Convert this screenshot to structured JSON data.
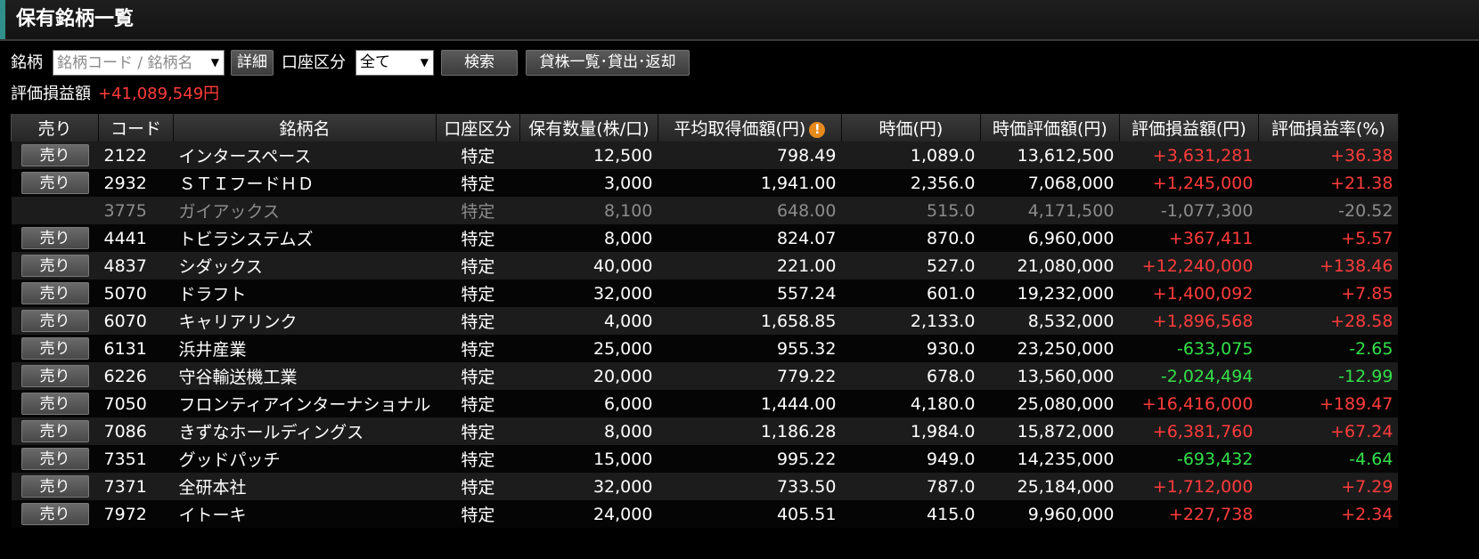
{
  "page": {
    "title": "保有銘柄一覧",
    "accent_color": "#2f8f8a"
  },
  "filters": {
    "symbol_label": "銘柄",
    "symbol_placeholder": "銘柄コード / 銘柄名",
    "detail_button": "詳細",
    "account_label": "口座区分",
    "account_selected": "全て",
    "search_button": "検索",
    "lending_button": "貸株一覧･貸出･返却"
  },
  "summary": {
    "label": "評価損益額",
    "value": "+41,089,549円"
  },
  "table": {
    "headers": [
      "売り",
      "コード",
      "銘柄名",
      "口座区分",
      "保有数量(株/口)",
      "平均取得価額(円)",
      "時価(円)",
      "時価評価額(円)",
      "評価損益額(円)",
      "評価損益率(%)"
    ],
    "sell_label": "売り",
    "rows": [
      {
        "sell": true,
        "code": "2122",
        "name": "インタースペース",
        "account": "特定",
        "qty": "12,500",
        "avg": "798.49",
        "price": "1,089.0",
        "value": "13,612,500",
        "pl": "+3,631,281",
        "rate": "+36.38",
        "status": "pos"
      },
      {
        "sell": true,
        "code": "2932",
        "name": "ＳＴＩフードＨＤ",
        "account": "特定",
        "qty": "3,000",
        "avg": "1,941.00",
        "price": "2,356.0",
        "value": "7,068,000",
        "pl": "+1,245,000",
        "rate": "+21.38",
        "status": "pos"
      },
      {
        "sell": false,
        "code": "3775",
        "name": "ガイアックス",
        "account": "特定",
        "qty": "8,100",
        "avg": "648.00",
        "price": "515.0",
        "value": "4,171,500",
        "pl": "-1,077,300",
        "rate": "-20.52",
        "status": "grey"
      },
      {
        "sell": true,
        "code": "4441",
        "name": "トビラシステムズ",
        "account": "特定",
        "qty": "8,000",
        "avg": "824.07",
        "price": "870.0",
        "value": "6,960,000",
        "pl": "+367,411",
        "rate": "+5.57",
        "status": "pos"
      },
      {
        "sell": true,
        "code": "4837",
        "name": "シダックス",
        "account": "特定",
        "qty": "40,000",
        "avg": "221.00",
        "price": "527.0",
        "value": "21,080,000",
        "pl": "+12,240,000",
        "rate": "+138.46",
        "status": "pos"
      },
      {
        "sell": true,
        "code": "5070",
        "name": "ドラフト",
        "account": "特定",
        "qty": "32,000",
        "avg": "557.24",
        "price": "601.0",
        "value": "19,232,000",
        "pl": "+1,400,092",
        "rate": "+7.85",
        "status": "pos"
      },
      {
        "sell": true,
        "code": "6070",
        "name": "キャリアリンク",
        "account": "特定",
        "qty": "4,000",
        "avg": "1,658.85",
        "price": "2,133.0",
        "value": "8,532,000",
        "pl": "+1,896,568",
        "rate": "+28.58",
        "status": "pos"
      },
      {
        "sell": true,
        "code": "6131",
        "name": "浜井産業",
        "account": "特定",
        "qty": "25,000",
        "avg": "955.32",
        "price": "930.0",
        "value": "23,250,000",
        "pl": "-633,075",
        "rate": "-2.65",
        "status": "neg"
      },
      {
        "sell": true,
        "code": "6226",
        "name": "守谷輸送機工業",
        "account": "特定",
        "qty": "20,000",
        "avg": "779.22",
        "price": "678.0",
        "value": "13,560,000",
        "pl": "-2,024,494",
        "rate": "-12.99",
        "status": "neg"
      },
      {
        "sell": true,
        "code": "7050",
        "name": "フロンティアインターナショナル",
        "account": "特定",
        "qty": "6,000",
        "avg": "1,444.00",
        "price": "4,180.0",
        "value": "25,080,000",
        "pl": "+16,416,000",
        "rate": "+189.47",
        "status": "pos"
      },
      {
        "sell": true,
        "code": "7086",
        "name": "きずなホールディングス",
        "account": "特定",
        "qty": "8,000",
        "avg": "1,186.28",
        "price": "1,984.0",
        "value": "15,872,000",
        "pl": "+6,381,760",
        "rate": "+67.24",
        "status": "pos"
      },
      {
        "sell": true,
        "code": "7351",
        "name": "グッドパッチ",
        "account": "特定",
        "qty": "15,000",
        "avg": "995.22",
        "price": "949.0",
        "value": "14,235,000",
        "pl": "-693,432",
        "rate": "-4.64",
        "status": "neg"
      },
      {
        "sell": true,
        "code": "7371",
        "name": "全研本社",
        "account": "特定",
        "qty": "32,000",
        "avg": "733.50",
        "price": "787.0",
        "value": "25,184,000",
        "pl": "+1,712,000",
        "rate": "+7.29",
        "status": "pos"
      },
      {
        "sell": true,
        "code": "7972",
        "name": "イトーキ",
        "account": "特定",
        "qty": "24,000",
        "avg": "405.51",
        "price": "415.0",
        "value": "9,960,000",
        "pl": "+227,738",
        "rate": "+2.34",
        "status": "pos"
      }
    ]
  },
  "colors": {
    "positive": "#ff3b3b",
    "negative": "#33e04a",
    "muted": "#8c8c8c"
  },
  "icons": {
    "avg_price_header": "warning-icon",
    "select_caret": "caret-down-icon"
  }
}
